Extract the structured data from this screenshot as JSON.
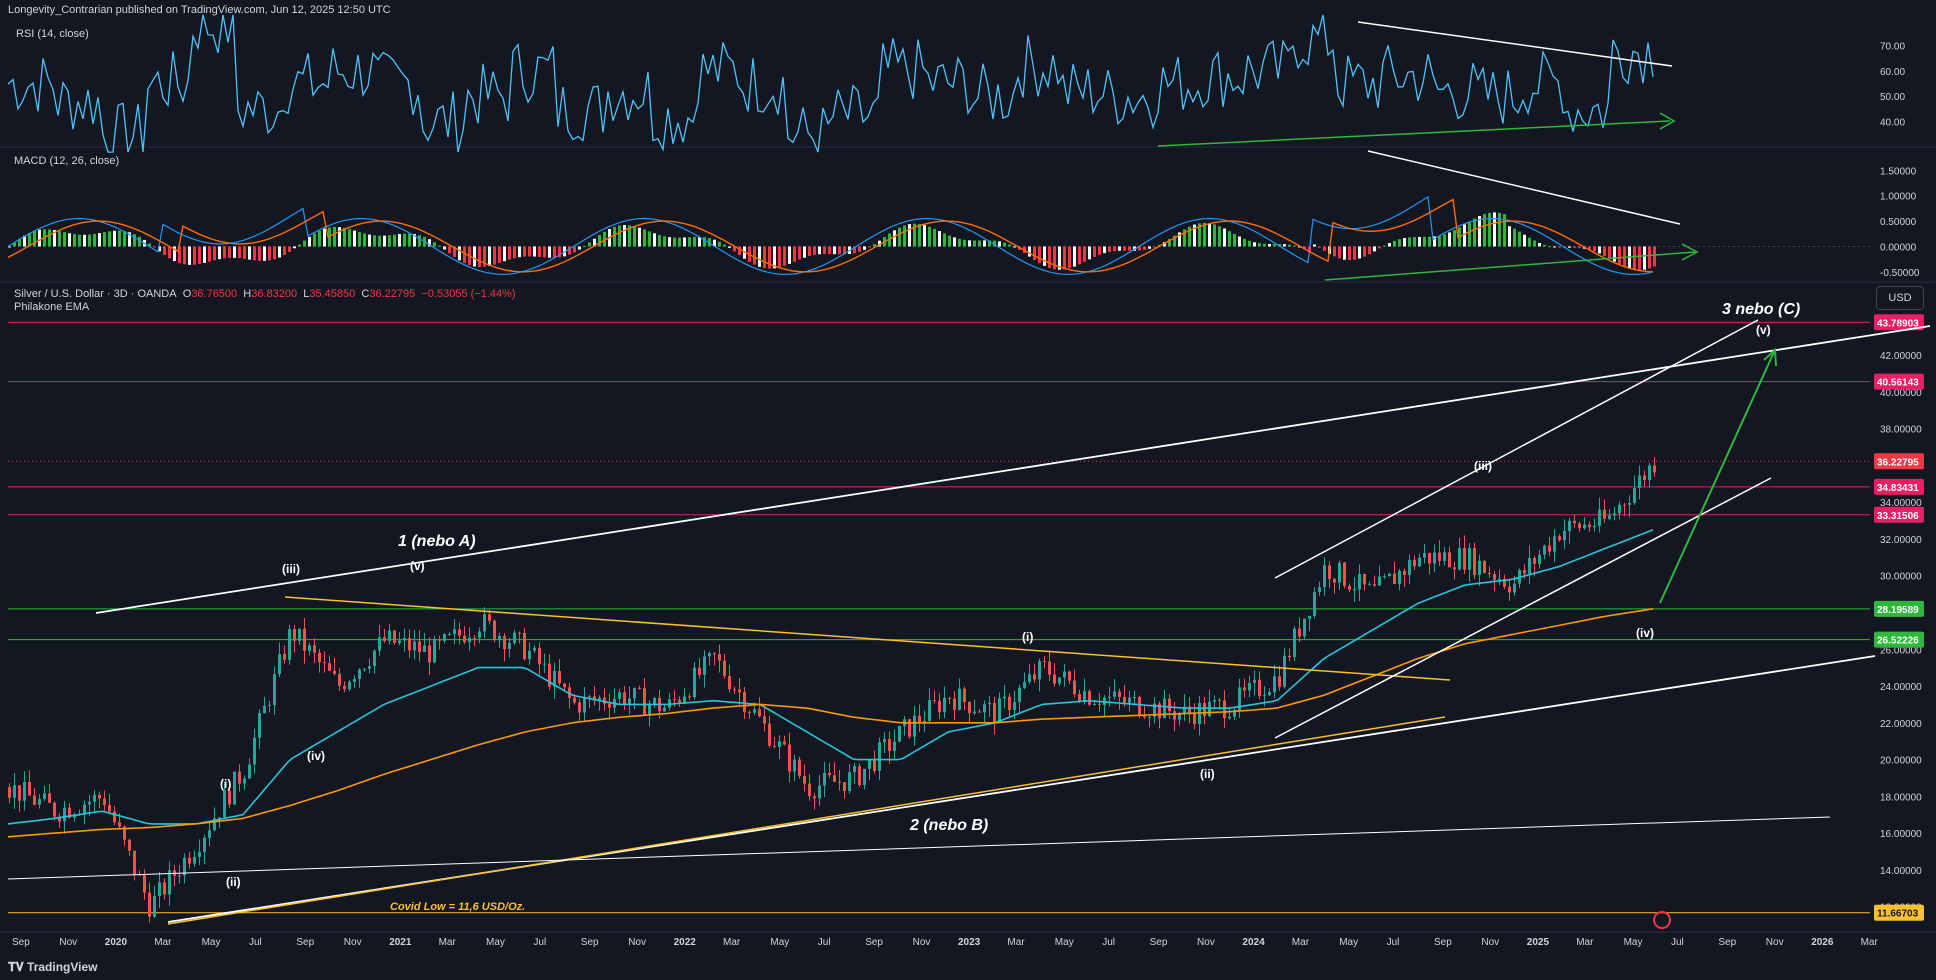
{
  "header": {
    "credit": "Longevity_Contrarian published on TradingView.com, Jun 12, 2025 12:50 UTC"
  },
  "footer": {
    "logo": "TradingView"
  },
  "rsi_pane": {
    "label": "RSI (14, close)",
    "ticks": [
      "70.00",
      "60.00",
      "50.00",
      "40.00"
    ],
    "ylim": [
      30,
      80
    ],
    "color": "#4fc3f7"
  },
  "macd_pane": {
    "label": "MACD (12, 26, close)",
    "ticks": [
      "1.50000",
      "1.00000",
      "0.50000",
      "0.00000",
      "-0.50000"
    ],
    "ylim": [
      -0.7,
      1.9
    ],
    "macd_color": "#2196f3",
    "signal_color": "#ff6d00"
  },
  "price_pane": {
    "symbol": "Silver / U.S. Dollar · 3D · OANDA",
    "o_label": "O",
    "o": "36.76500",
    "h_label": "H",
    "h": "36.83200",
    "l_label": "L",
    "l": "35.45850",
    "c_label": "C",
    "c": "36.22795",
    "change": "−0.53055 (−1.44%)",
    "indicator": "Philakone EMA",
    "currency": "USD",
    "ticks": [
      "42.00000",
      "40.00000",
      "38.00000",
      "34.00000",
      "32.00000",
      "30.00000",
      "26.00000",
      "24.00000",
      "22.00000",
      "20.00000",
      "18.00000",
      "16.00000",
      "14.00000",
      "12.00000"
    ]
  },
  "price_badges": [
    {
      "value": "43.78903",
      "color": "#e91e63"
    },
    {
      "value": "40.56143",
      "color": "#e91e63"
    },
    {
      "value": "36.22795",
      "color": "#f23645"
    },
    {
      "value": "34.83431",
      "color": "#e91e63"
    },
    {
      "value": "33.31506",
      "color": "#e91e63"
    },
    {
      "value": "28.19589",
      "color": "#2db83d"
    },
    {
      "value": "26.52226",
      "color": "#2db83d"
    },
    {
      "value": "11.66703",
      "color": "#fbc02d"
    }
  ],
  "annotations": {
    "wave_1": "1 (nebo A)",
    "wave_2": "2 (nebo B)",
    "wave_3": "3 nebo (C)",
    "covid": "Covid Low = 11,6 USD/Oz.",
    "left_i": "(i)",
    "left_ii": "(ii)",
    "left_iii": "(iii)",
    "left_iv": "(iv)",
    "left_v": "(v)",
    "right_i": "(i)",
    "right_ii": "(ii)",
    "right_iii": "(iii)",
    "right_iv": "(iv)",
    "right_v": "(v)"
  },
  "time_axis": [
    "Sep",
    "Nov",
    "2020",
    "Mar",
    "May",
    "Jul",
    "Sep",
    "Nov",
    "2021",
    "Mar",
    "May",
    "Jul",
    "Sep",
    "Nov",
    "2022",
    "Mar",
    "May",
    "Jul",
    "Sep",
    "Nov",
    "2023",
    "Mar",
    "May",
    "Jul",
    "Sep",
    "Nov",
    "2024",
    "Mar",
    "May",
    "Jul",
    "Sep",
    "Nov",
    "2025",
    "Mar",
    "May",
    "Jul",
    "Sep",
    "Nov",
    "2026",
    "Mar"
  ],
  "chart_data": {
    "type": "line",
    "title": "Silver / U.S. Dollar · 3D · OANDA",
    "xlabel": "",
    "ylabel": "",
    "ylim": [
      11,
      45
    ],
    "x": [
      "2019-09",
      "2019-11",
      "2020-01",
      "2020-03",
      "2020-05",
      "2020-07",
      "2020-09",
      "2020-11",
      "2021-01",
      "2021-03",
      "2021-05",
      "2021-07",
      "2021-09",
      "2021-11",
      "2022-01",
      "2022-03",
      "2022-05",
      "2022-07",
      "2022-09",
      "2022-11",
      "2023-01",
      "2023-03",
      "2023-05",
      "2023-07",
      "2023-09",
      "2023-11",
      "2024-01",
      "2024-03",
      "2024-05",
      "2024-07",
      "2024-09",
      "2024-11",
      "2025-01",
      "2025-03",
      "2025-05",
      "2025-06"
    ],
    "series": [
      {
        "name": "Silver / U.S. Dollar",
        "values": [
          18.5,
          17.2,
          18.0,
          12.0,
          15.5,
          19.5,
          27.0,
          24.0,
          26.5,
          25.8,
          27.5,
          26.0,
          23.0,
          23.5,
          22.8,
          25.5,
          22.0,
          18.5,
          19.0,
          21.5,
          23.5,
          22.5,
          25.0,
          23.5,
          23.0,
          22.5,
          23.0,
          24.5,
          30.5,
          29.0,
          31.0,
          31.0,
          29.5,
          32.5,
          33.0,
          36.2
        ]
      },
      {
        "values": [
          16.5,
          16.8,
          17.2,
          16.5,
          16.5,
          17.0,
          20.0,
          21.5,
          23.0,
          24.0,
          25.0,
          25.0,
          23.5,
          23.0,
          23.0,
          23.2,
          23.0,
          21.5,
          20.0,
          20.0,
          21.5,
          22.0,
          23.0,
          23.2,
          23.0,
          22.8,
          22.8,
          23.2,
          25.5,
          27.0,
          28.5,
          29.5,
          29.8,
          30.5,
          31.5,
          32.5
        ]
      },
      {
        "values": [
          15.8,
          16.0,
          16.2,
          16.3,
          16.5,
          16.8,
          17.5,
          18.3,
          19.2,
          20.0,
          20.8,
          21.5,
          22.0,
          22.3,
          22.5,
          22.8,
          23.0,
          22.8,
          22.3,
          22.0,
          22.0,
          22.0,
          22.2,
          22.3,
          22.4,
          22.5,
          22.6,
          22.8,
          23.5,
          24.5,
          25.5,
          26.3,
          26.8,
          27.3,
          27.8,
          28.2
        ]
      }
    ],
    "levels": [
      43.78903,
      40.56143,
      34.83431,
      33.31506,
      28.19589,
      26.52226,
      11.66703
    ]
  }
}
